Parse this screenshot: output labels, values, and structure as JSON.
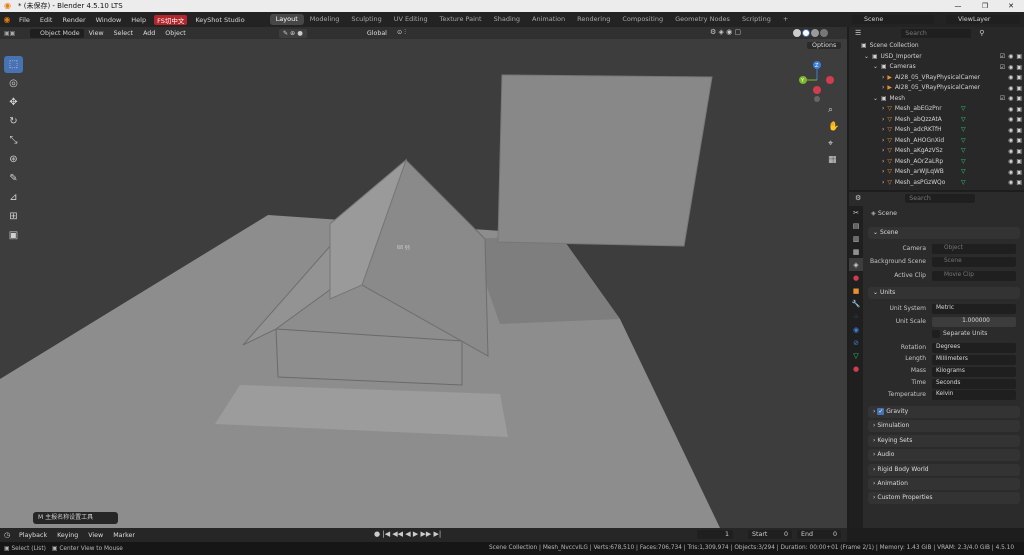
{
  "window": {
    "title": "* (未保存) - Blender 4.5.10 LTS",
    "minimize": "—",
    "maximize": "❐",
    "close": "✕"
  },
  "menu": {
    "items": [
      "File",
      "Edit",
      "Render",
      "Window",
      "Help"
    ],
    "fs_label": "FS切中文",
    "keyshot": "KeyShot Studio"
  },
  "workspaces": [
    "Layout",
    "Modeling",
    "Sculpting",
    "UV Editing",
    "Texture Paint",
    "Shading",
    "Animation",
    "Rendering",
    "Compositing",
    "Geometry Nodes",
    "Scripting"
  ],
  "workspace_add": "+",
  "scene_selector": "Scene",
  "viewlayer_selector": "ViewLayer",
  "viewport_header": {
    "mode": "Object Mode",
    "menus": [
      "View",
      "Select",
      "Add",
      "Object"
    ],
    "orientation": "Global",
    "options": "Options"
  },
  "gizmo": {
    "y": "Y",
    "z": "Z"
  },
  "roof_text": "ßß §§",
  "last_operator": "M 主报名称设置工具",
  "timeline": {
    "menus": [
      "Playback",
      "Keying",
      "View",
      "Marker"
    ],
    "current_frame": "1",
    "start_label": "Start",
    "start": "0",
    "end_label": "End",
    "end": "0"
  },
  "statusbar": {
    "left": "Select (List)",
    "center": "Center View to Mouse",
    "info": "Scene Collection | Mesh_NvccvlLG | Verts:678,510 | Faces:706,734 | Tris:1,309,974 | Objects:3/294 | Duration: 00:00+01 (Frame 2/1) | Memory: 1.43 GiB | VRAM: 2.3/4.0 GiB | 4.5.10"
  },
  "outliner": {
    "search_placeholder": "Search",
    "root": "Scene Collection",
    "rows": [
      {
        "label": "USD_Importer",
        "indent": 1,
        "check": true
      },
      {
        "label": "Cameras",
        "indent": 2,
        "check": true
      },
      {
        "label": "AI28_05_VRayPhysicalCamer",
        "indent": 3,
        "check": false
      },
      {
        "label": "AI28_05_VRayPhysicalCamer",
        "indent": 3,
        "check": false
      },
      {
        "label": "Mesh",
        "indent": 2,
        "check": true
      },
      {
        "label": "Mesh_abEGzPnr",
        "indent": 3,
        "check": false
      },
      {
        "label": "Mesh_abQzzAtA",
        "indent": 3,
        "check": false
      },
      {
        "label": "Mesh_adcRKTfH",
        "indent": 3,
        "check": false
      },
      {
        "label": "Mesh_AHOGnXid",
        "indent": 3,
        "check": false
      },
      {
        "label": "Mesh_aKgAzVSz",
        "indent": 3,
        "check": false
      },
      {
        "label": "Mesh_AOrZaLRp",
        "indent": 3,
        "check": false
      },
      {
        "label": "Mesh_arWJLqWB",
        "indent": 3,
        "check": false
      },
      {
        "label": "Mesh_asPGzWQo",
        "indent": 3,
        "check": false
      }
    ]
  },
  "properties": {
    "search_placeholder": "Search",
    "context": "Scene",
    "scene_panel": "Scene",
    "camera_label": "Camera",
    "camera_placeholder": "Object",
    "bg_scene_label": "Background Scene",
    "bg_scene_placeholder": "Scene",
    "active_clip_label": "Active Clip",
    "active_clip_placeholder": "Movie Clip",
    "units_panel": "Units",
    "unit_system_label": "Unit System",
    "unit_system": "Metric",
    "unit_scale_label": "Unit Scale",
    "unit_scale": "1.000000",
    "separate_units": "Separate Units",
    "rotation_label": "Rotation",
    "rotation": "Degrees",
    "length_label": "Length",
    "length": "Millimeters",
    "mass_label": "Mass",
    "mass": "Kilograms",
    "time_label": "Time",
    "time": "Seconds",
    "temperature_label": "Temperature",
    "temperature": "Kelvin",
    "panels": [
      "Gravity",
      "Simulation",
      "Keying Sets",
      "Audio",
      "Rigid Body World",
      "Animation",
      "Custom Properties"
    ]
  },
  "colors": {
    "accent": "#4772b3",
    "fs_badge": "#b3262c",
    "gizmo_x": "#d13d4f",
    "gizmo_y": "#7bb82a",
    "gizmo_z": "#3b7fd6",
    "mesh_icon": "#e8902d",
    "modifier_icon": "#2fd07a"
  }
}
